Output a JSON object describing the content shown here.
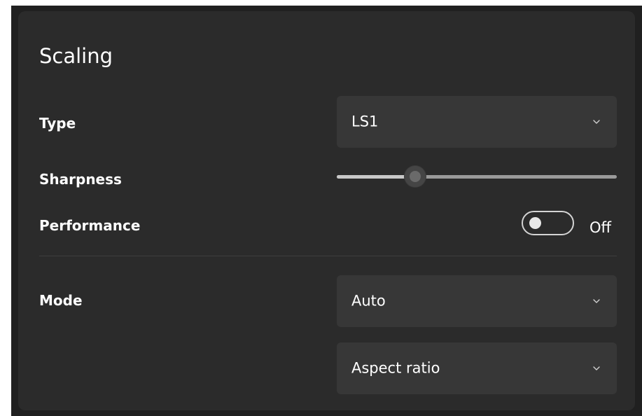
{
  "section": {
    "title": "Scaling"
  },
  "type_row": {
    "label": "Type",
    "value": "LS1"
  },
  "sharpness_row": {
    "label": "Sharpness",
    "level_fraction": 0.28
  },
  "performance_row": {
    "label": "Performance",
    "toggle_on": false,
    "state_label": "Off"
  },
  "mode_row": {
    "label": "Mode",
    "value": "Auto"
  },
  "aspect_dropdown": {
    "value": "Aspect ratio"
  },
  "icons": {
    "dropdown_chevron": "chevron-down-icon"
  },
  "colors": {
    "background": "#202020",
    "card": "#2b2b2b",
    "control": "#373737",
    "text": "#ffffff"
  }
}
